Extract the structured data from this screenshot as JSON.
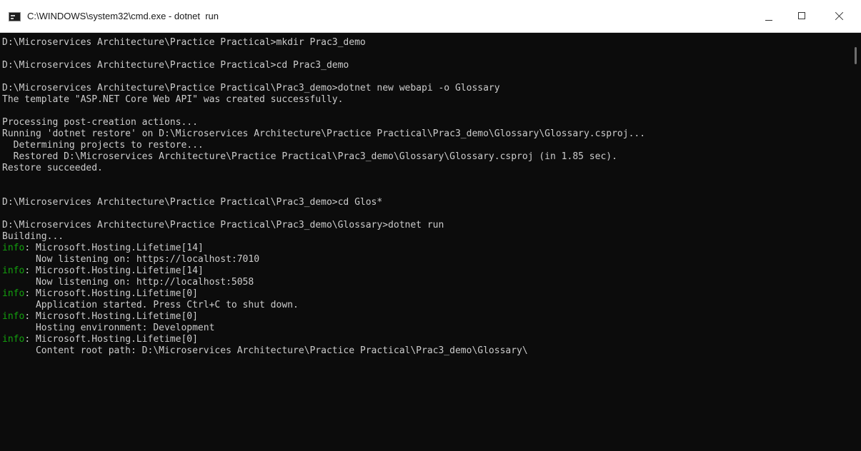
{
  "window": {
    "title": "C:\\WINDOWS\\system32\\cmd.exe - dotnet  run",
    "icon": "console-app-icon",
    "controls": {
      "minimize": "minimize-icon",
      "maximize": "maximize-icon",
      "close": "close-icon"
    }
  },
  "console": {
    "colors": {
      "background": "#0c0c0c",
      "foreground": "#cccccc",
      "info": "#13a10e"
    },
    "lines": [
      {
        "text": "D:\\Microservices Architecture\\Practice Practical>mkdir Prac3_demo"
      },
      {
        "text": ""
      },
      {
        "text": "D:\\Microservices Architecture\\Practice Practical>cd Prac3_demo"
      },
      {
        "text": ""
      },
      {
        "text": "D:\\Microservices Architecture\\Practice Practical\\Prac3_demo>dotnet new webapi -o Glossary"
      },
      {
        "text": "The template \"ASP.NET Core Web API\" was created successfully."
      },
      {
        "text": ""
      },
      {
        "text": "Processing post-creation actions..."
      },
      {
        "text": "Running 'dotnet restore' on D:\\Microservices Architecture\\Practice Practical\\Prac3_demo\\Glossary\\Glossary.csproj..."
      },
      {
        "text": "  Determining projects to restore..."
      },
      {
        "text": "  Restored D:\\Microservices Architecture\\Practice Practical\\Prac3_demo\\Glossary\\Glossary.csproj (in 1.85 sec)."
      },
      {
        "text": "Restore succeeded."
      },
      {
        "text": ""
      },
      {
        "text": ""
      },
      {
        "text": "D:\\Microservices Architecture\\Practice Practical\\Prac3_demo>cd Glos*"
      },
      {
        "text": ""
      },
      {
        "text": "D:\\Microservices Architecture\\Practice Practical\\Prac3_demo\\Glossary>dotnet run"
      },
      {
        "text": "Building..."
      },
      {
        "level": "info",
        "text": ": Microsoft.Hosting.Lifetime[14]"
      },
      {
        "text": "      Now listening on: https://localhost:7010"
      },
      {
        "level": "info",
        "text": ": Microsoft.Hosting.Lifetime[14]"
      },
      {
        "text": "      Now listening on: http://localhost:5058"
      },
      {
        "level": "info",
        "text": ": Microsoft.Hosting.Lifetime[0]"
      },
      {
        "text": "      Application started. Press Ctrl+C to shut down."
      },
      {
        "level": "info",
        "text": ": Microsoft.Hosting.Lifetime[0]"
      },
      {
        "text": "      Hosting environment: Development"
      },
      {
        "level": "info",
        "text": ": Microsoft.Hosting.Lifetime[0]"
      },
      {
        "text": "      Content root path: D:\\Microservices Architecture\\Practice Practical\\Prac3_demo\\Glossary\\"
      }
    ]
  }
}
